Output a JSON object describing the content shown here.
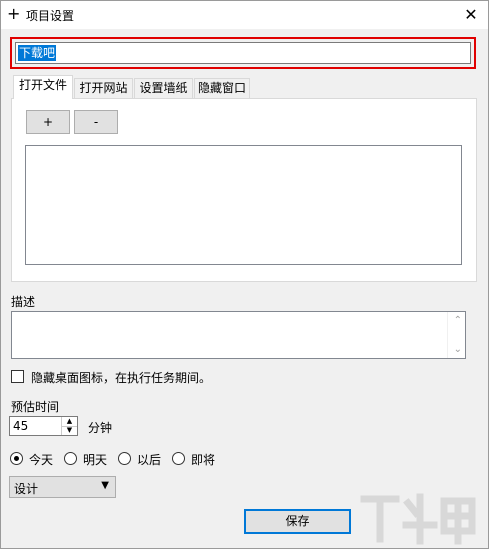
{
  "window": {
    "title": "项目设置",
    "title_icon": "plus-icon",
    "close_glyph": "✕"
  },
  "project_name": {
    "value": "下载吧"
  },
  "tabs": [
    {
      "label": "打开文件",
      "active": true
    },
    {
      "label": "打开网站",
      "active": false
    },
    {
      "label": "设置墙纸",
      "active": false
    },
    {
      "label": "隐藏窗口",
      "active": false
    }
  ],
  "file_tab": {
    "add_label": "+",
    "remove_label": "-"
  },
  "description": {
    "label": "描述"
  },
  "hide_icons": {
    "label": "隐藏桌面图标，在执行任务期间。",
    "checked": false
  },
  "estimate": {
    "label": "预估时间",
    "value": "45",
    "unit": "分钟"
  },
  "schedule": {
    "options": [
      {
        "label": "今天",
        "selected": true
      },
      {
        "label": "明天",
        "selected": false
      },
      {
        "label": "以后",
        "selected": false
      },
      {
        "label": "即将",
        "selected": false
      }
    ]
  },
  "category": {
    "selected": "设计"
  },
  "footer": {
    "save_label": "保存"
  },
  "colors": {
    "highlight_border": "#e00000",
    "selection": "#0078d7",
    "window_bg": "#f0f0f0"
  }
}
